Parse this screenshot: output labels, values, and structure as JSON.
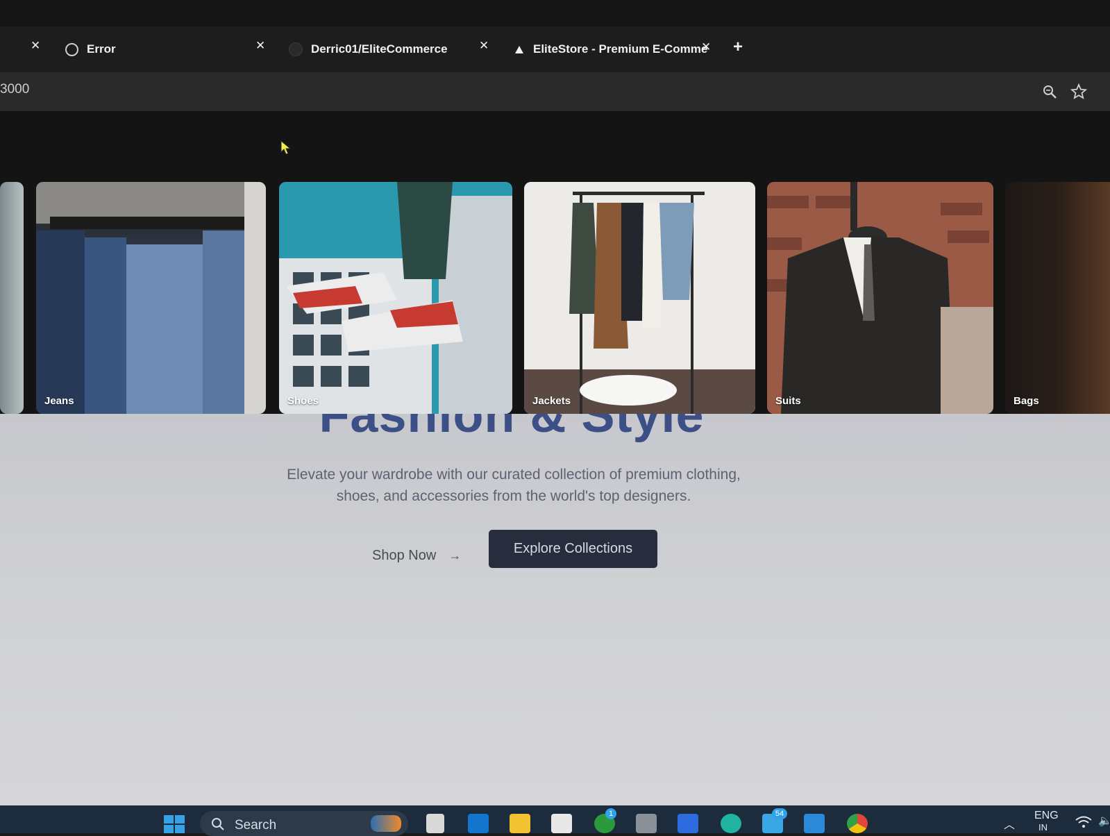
{
  "browser": {
    "tabs": [
      {
        "title": "Error"
      },
      {
        "title": "Derric01/EliteCommerce"
      },
      {
        "title": "EliteStore - Premium E-Comme"
      }
    ],
    "url_partial": "3000"
  },
  "categories": [
    {
      "label": "Jeans"
    },
    {
      "label": "Shoes"
    },
    {
      "label": "Jackets"
    },
    {
      "label": "Suits"
    },
    {
      "label": "Bags"
    }
  ],
  "hero": {
    "title": "Fashion & Style",
    "subtitle_line1": "Elevate your wardrobe with our curated collection of premium clothing,",
    "subtitle_line2": "shoes, and accessories from the world's top designers.",
    "shop_now": "Shop Now",
    "explore": "Explore Collections"
  },
  "taskbar": {
    "search_label": "Search",
    "lang": "ENG",
    "region": "IN",
    "badges": [
      "1",
      "54"
    ]
  },
  "colors": {
    "hero_title": "#3c4f86",
    "explore_bg": "#272d3c",
    "page_bg": "#cfd0d4"
  }
}
